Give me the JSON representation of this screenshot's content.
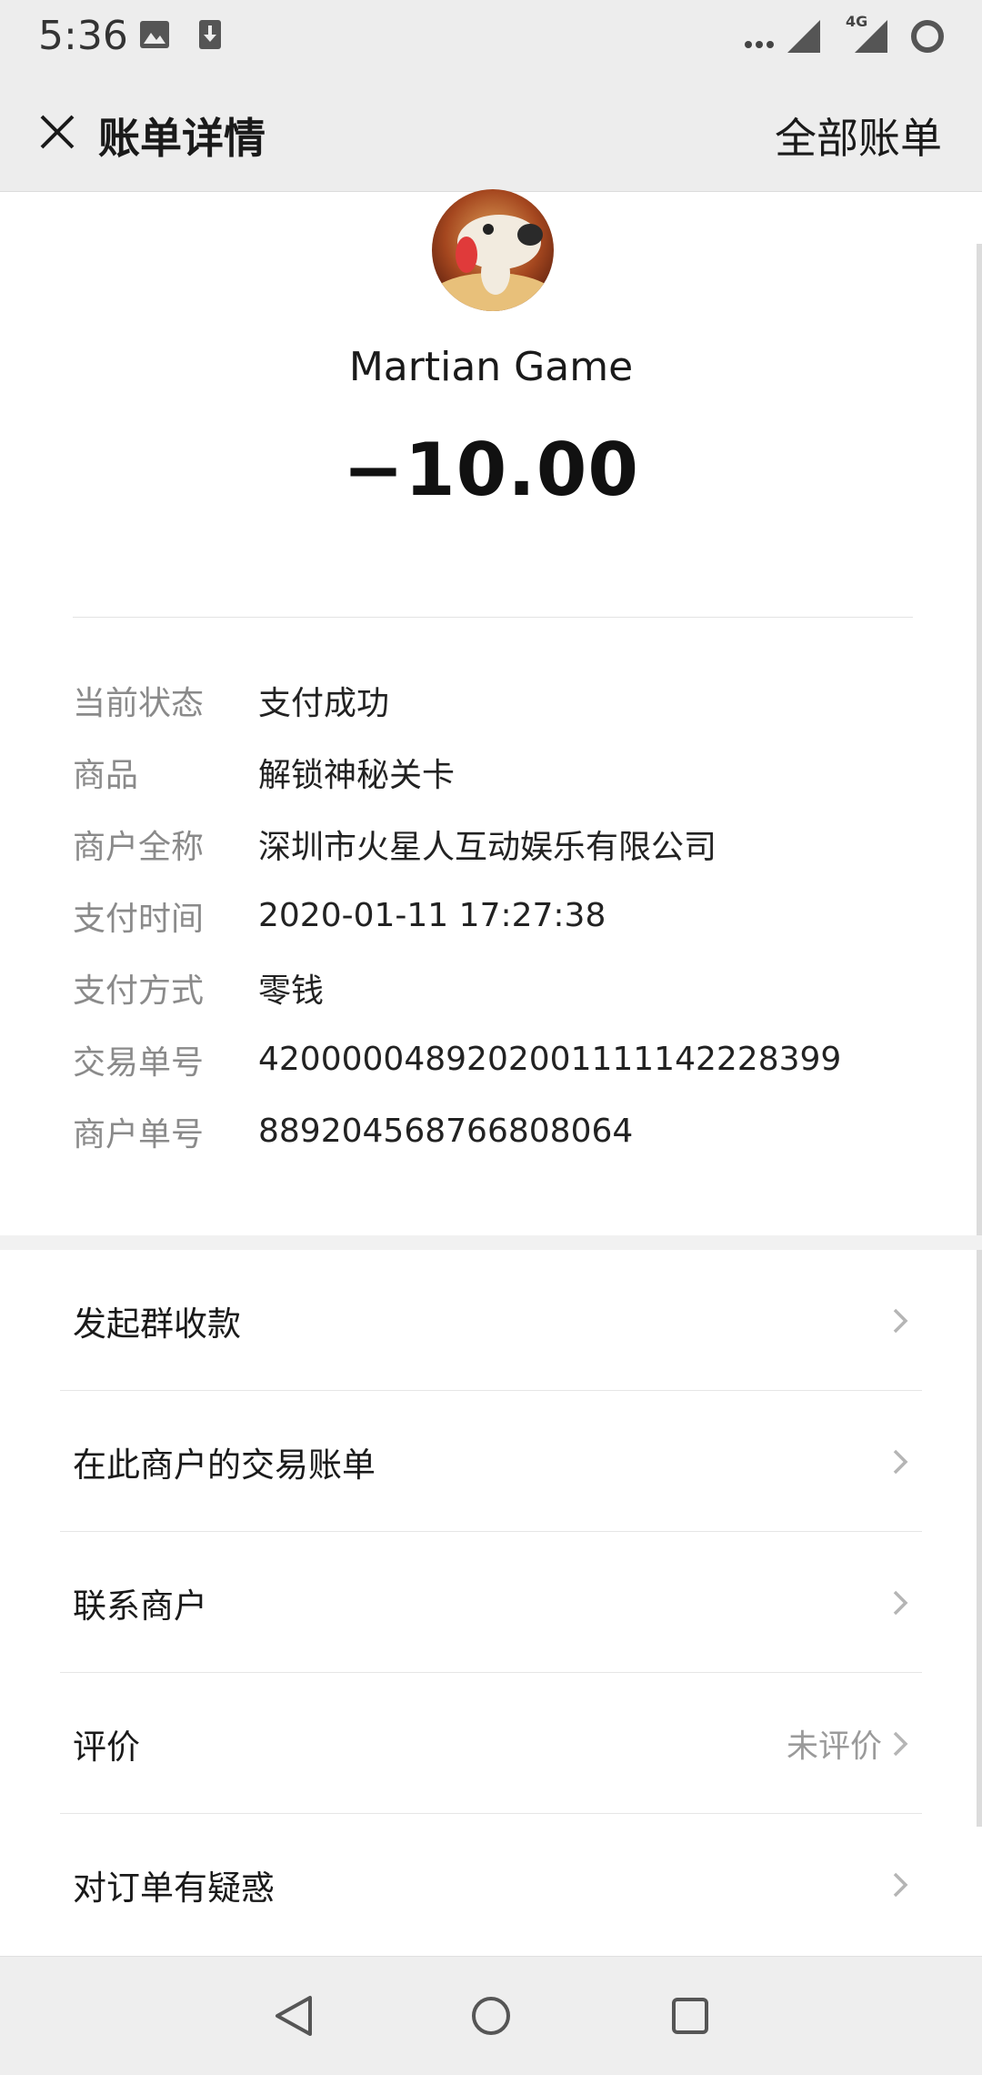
{
  "status_bar": {
    "time": "5:36",
    "icons": [
      "image-icon",
      "download-icon",
      "more-dots-icon",
      "signal-icon",
      "network-4g-icon",
      "battery-ring-icon"
    ],
    "network_label": "4G"
  },
  "app_bar": {
    "title": "账单详情",
    "right_action": "全部账单"
  },
  "header": {
    "merchant_name": "Martian Game",
    "amount": "−10.00"
  },
  "details": [
    {
      "label": "当前状态",
      "value": "支付成功"
    },
    {
      "label": "商品",
      "value": "解锁神秘关卡"
    },
    {
      "label": "商户全称",
      "value": "深圳市火星人互动娱乐有限公司"
    },
    {
      "label": "支付时间",
      "value": "2020-01-11 17:27:38"
    },
    {
      "label": "支付方式",
      "value": "零钱"
    },
    {
      "label": "交易单号",
      "value": "4200000489202001111142228399"
    },
    {
      "label": "商户单号",
      "value": "889204568766808064"
    }
  ],
  "menu": [
    {
      "label": "发起群收款",
      "right": ""
    },
    {
      "label": "在此商户的交易账单",
      "right": ""
    },
    {
      "label": "联系商户",
      "right": ""
    },
    {
      "label": "评价",
      "right": "未评价"
    },
    {
      "label": "对订单有疑惑",
      "right": ""
    }
  ],
  "colors": {
    "bar_background": "#ededed",
    "label_gray": "#8a8a8a",
    "text": "#1a1a1a"
  }
}
